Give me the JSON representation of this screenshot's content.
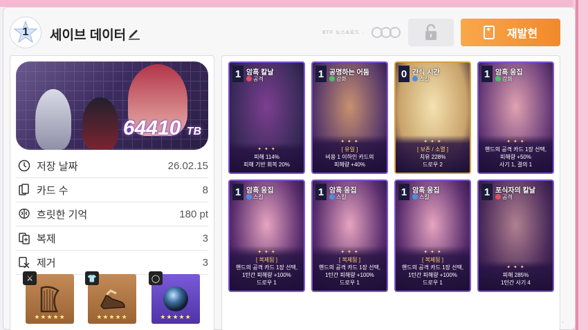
{
  "header": {
    "level": "1",
    "title": "세이브 데이터",
    "fine_text": "BTF 뉴스&로드 ·",
    "reissue_label": "재발현"
  },
  "hero": {
    "score": "64410",
    "score_unit": "TB"
  },
  "stats": [
    {
      "icon": "clock-icon",
      "label": "저장 날짜",
      "value": "26.02.15"
    },
    {
      "icon": "cards-icon",
      "label": "카드 수",
      "value": "8"
    },
    {
      "icon": "brain-icon",
      "label": "흐릿한 기억",
      "value": "180 pt"
    },
    {
      "icon": "duplicate-icon",
      "label": "복제",
      "value": "3"
    },
    {
      "icon": "remove-icon",
      "label": "제거",
      "value": "3"
    }
  ],
  "equipment": [
    {
      "slot": "weapon",
      "slot_icon": "sword-icon",
      "item": "harp",
      "color": "#b47b4c",
      "stars": "★★★★★"
    },
    {
      "slot": "armor",
      "slot_icon": "armor-icon",
      "item": "boots",
      "color": "#b47b4c",
      "stars": "★★★★★"
    },
    {
      "slot": "accessory",
      "slot_icon": "ring-icon",
      "item": "orb",
      "color": "#6c4bc8",
      "stars": "★★★★★"
    }
  ],
  "cards": [
    {
      "cost": "1",
      "name": "암흑 칼날",
      "type": "공격",
      "type_color": "#e0505a",
      "frame": "purple",
      "desc": [
        "피해 114%",
        "피해 기반 회복 20%"
      ],
      "art": [
        "#3a2a5a",
        "#7c3f8f"
      ]
    },
    {
      "cost": "1",
      "name": "공명하는 어둠",
      "type": "강화",
      "type_color": "#48c26a",
      "frame": "purple",
      "desc": [
        "[ 유일 ]",
        "비용 1 이하인 카드의",
        "피해량 +40%"
      ],
      "art": [
        "#5a3a6a",
        "#c89070"
      ]
    },
    {
      "cost": "0",
      "name": "간식 시간",
      "type": "스킬",
      "type_color": "#4a90e2",
      "frame": "orange",
      "desc": [
        "[ 보존 / 소멸 ]",
        "치유 228%",
        "드로우 2"
      ],
      "art": [
        "#c9a26a",
        "#f3e2b0"
      ]
    },
    {
      "cost": "1",
      "name": "암흑 응집",
      "type": "강화",
      "type_color": "#48c26a",
      "frame": "purple",
      "desc": [
        "핸드의 공격 카드 1장 선택,",
        "피해량 +50%",
        "사기 1, 결의 1"
      ],
      "art": [
        "#6b3d7a",
        "#e0a2b0"
      ]
    },
    {
      "cost": "1",
      "name": "암흑 응집",
      "type": "스킬",
      "type_color": "#4a90e2",
      "frame": "purple",
      "desc": [
        "[ 복제됨 ]",
        "핸드의 공격 카드 1장 선택,",
        "1턴간 피해량 +100%",
        "드로우 1"
      ],
      "art": [
        "#5b2e6e",
        "#e6a4c0"
      ]
    },
    {
      "cost": "1",
      "name": "암흑 응집",
      "type": "스킬",
      "type_color": "#4a90e2",
      "frame": "purple",
      "desc": [
        "[ 복제됨 ]",
        "핸드의 공격 카드 1장 선택,",
        "1턴간 피해량 +100%",
        "드로우 1"
      ],
      "art": [
        "#5b2e6e",
        "#e6a4c0"
      ]
    },
    {
      "cost": "1",
      "name": "암흑 응집",
      "type": "스킬",
      "type_color": "#4a90e2",
      "frame": "purple",
      "desc": [
        "[ 복제됨 ]",
        "핸드의 공격 카드 1장 선택,",
        "1턴간 피해량 +100%",
        "드로우 1"
      ],
      "art": [
        "#5b2e6e",
        "#e6a4c0"
      ]
    },
    {
      "cost": "1",
      "name": "포식자의 칼날",
      "type": "공격",
      "type_color": "#e0505a",
      "frame": "purple",
      "desc": [
        "피해 285%",
        "1턴간 사기 4"
      ],
      "art": [
        "#4a2a5a",
        "#b08090"
      ]
    }
  ]
}
